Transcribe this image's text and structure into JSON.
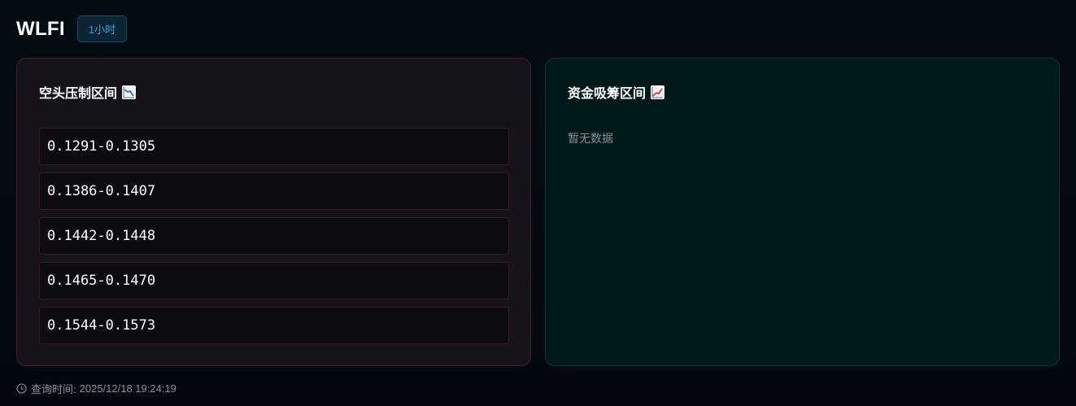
{
  "header": {
    "symbol": "WLFI",
    "timeframe": "1小时"
  },
  "short_panel": {
    "title": "空头压制区间",
    "icon": "chart-decreasing-icon",
    "zones": [
      "0.1291-0.1305",
      "0.1386-0.1407",
      "0.1442-0.1448",
      "0.1465-0.1470",
      "0.1544-0.1573"
    ]
  },
  "long_panel": {
    "title": "资金吸筹区间",
    "icon": "chart-increasing-icon",
    "empty_text": "暂无数据"
  },
  "footer": {
    "label": "查询时间:",
    "time": "2025/12/18 19:24:19"
  },
  "colors": {
    "accent": "#3a9fd8",
    "short_border": "#45202a",
    "long_border": "#123630"
  }
}
